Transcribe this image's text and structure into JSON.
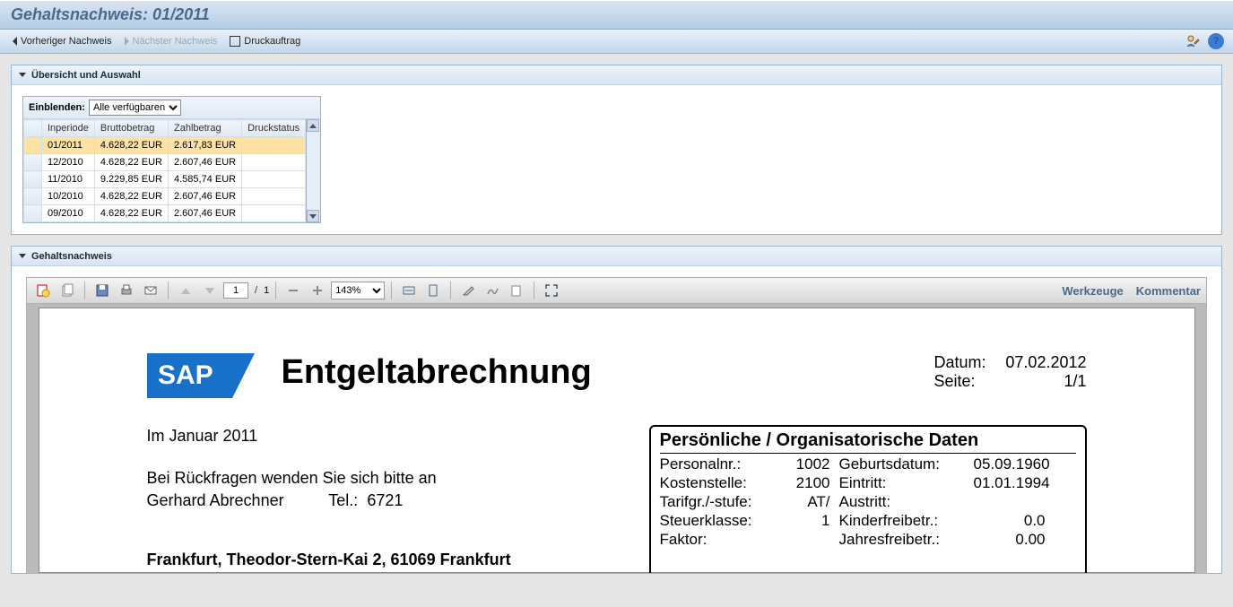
{
  "title": "Gehaltsnachweis: 01/2011",
  "nav": {
    "prev": "Vorheriger Nachweis",
    "next": "Nächster Nachweis",
    "print": "Druckauftrag"
  },
  "overview": {
    "header": "Übersicht und Auswahl",
    "filter_label": "Einblenden:",
    "filter_value": "Alle verfügbaren",
    "columns": {
      "period": "Inperiode",
      "gross": "Bruttobetrag",
      "pay": "Zahlbetrag",
      "printstatus": "Druckstatus"
    },
    "rows": [
      {
        "period": "01/2011",
        "gross": "4.628,22 EUR",
        "pay": "2.617,83 EUR",
        "printstatus": "",
        "selected": true
      },
      {
        "period": "12/2010",
        "gross": "4.628,22 EUR",
        "pay": "2.607,46 EUR",
        "printstatus": ""
      },
      {
        "period": "11/2010",
        "gross": "9.229,85 EUR",
        "pay": "4.585,74 EUR",
        "printstatus": ""
      },
      {
        "period": "10/2010",
        "gross": "4.628,22 EUR",
        "pay": "2.607,46 EUR",
        "printstatus": ""
      },
      {
        "period": "09/2010",
        "gross": "4.628,22 EUR",
        "pay": "2.607,46 EUR",
        "printstatus": ""
      }
    ]
  },
  "detail": {
    "header": "Gehaltsnachweis",
    "toolbar": {
      "page_current": "1",
      "page_total": "1",
      "page_sep": "/",
      "zoom": "143%",
      "tools": "Werkzeuge",
      "comment": "Kommentar"
    },
    "document": {
      "title": "Entgeltabrechnung",
      "date_label": "Datum:",
      "date_value": "07.02.2012",
      "page_label": "Seite:",
      "page_value": "1/1",
      "period_line": "Im Januar 2011",
      "contact_intro": "Bei Rückfragen wenden Sie sich bitte an",
      "contact_name": "Gerhard Abrechner",
      "contact_tel_label": "Tel.:",
      "contact_tel": "6721",
      "address": "Frankfurt, Theodor-Stern-Kai 2, 61069 Frankfurt",
      "box_title": "Persönliche / Organisatorische Daten",
      "fields": {
        "personalnr_l": "Personalnr.:",
        "personalnr_v": "1002",
        "geburt_l": "Geburtsdatum:",
        "geburt_v": "05.09.1960",
        "kosten_l": "Kostenstelle:",
        "kosten_v": "2100",
        "eintritt_l": "Eintritt:",
        "eintritt_v": "01.01.1994",
        "tarif_l": "Tarifgr./-stufe:",
        "tarif_v": "AT/",
        "austritt_l": "Austritt:",
        "austritt_v": "",
        "steuer_l": "Steuerklasse:",
        "steuer_v": "1",
        "kinder_l": "Kinderfreibetr.:",
        "kinder_v": "0.0",
        "faktor_l": "Faktor:",
        "faktor_v": "",
        "jahres_l": "Jahresfreibetr.:",
        "jahres_v": "0.00"
      }
    }
  }
}
